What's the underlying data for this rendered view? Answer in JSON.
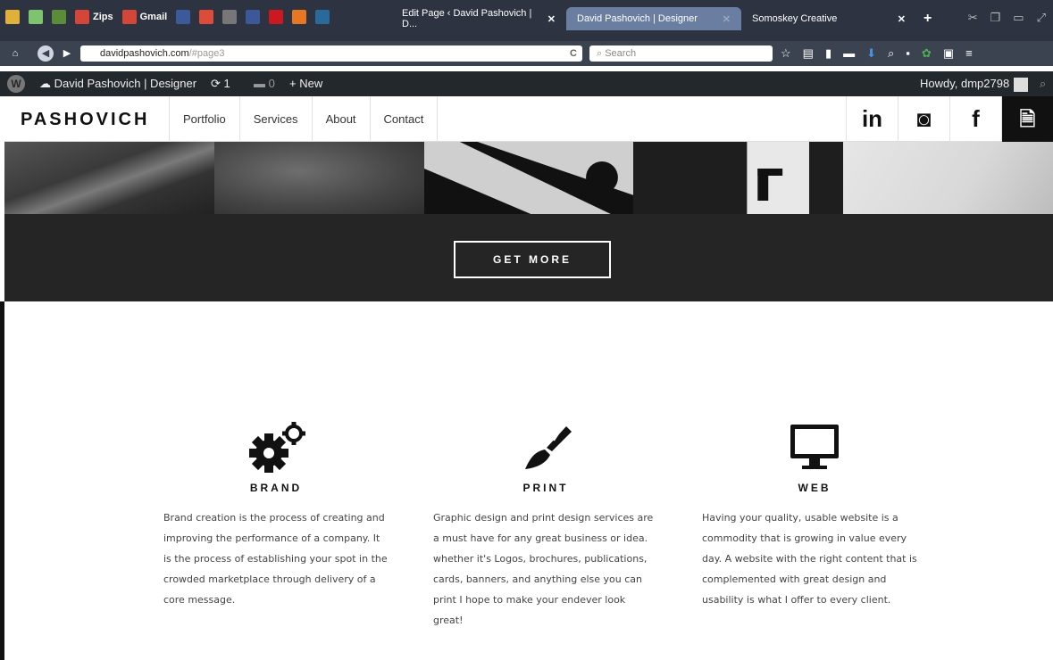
{
  "browser": {
    "bookmarks": [
      {
        "label": "",
        "color": "#e0b13a",
        "icon": "extension-icon"
      },
      {
        "label": "",
        "color": "#7ec36e",
        "icon": "calendar-icon"
      },
      {
        "label": "",
        "color": "#5a8c3a",
        "icon": "leaf-icon"
      },
      {
        "label": "Zips",
        "color": "#d44638",
        "icon": "gmail-icon"
      },
      {
        "label": "Gmail",
        "color": "#d44638",
        "icon": "gmail-icon"
      },
      {
        "label": "",
        "color": "#3b5a99",
        "icon": "rss-icon"
      },
      {
        "label": "",
        "color": "#dd4b39",
        "icon": "google-plus-icon"
      },
      {
        "label": "",
        "color": "#555",
        "icon": "instagram-icon"
      },
      {
        "label": "",
        "color": "#3b5998",
        "icon": "facebook-icon"
      },
      {
        "label": "",
        "color": "#cc181e",
        "icon": "youtube-icon"
      },
      {
        "label": "",
        "color": "#e87722",
        "icon": "blogger-icon"
      },
      {
        "label": "",
        "color": "#2a6a9a",
        "icon": "app-icon"
      }
    ],
    "tabs": [
      {
        "label": "Edit Page ‹ David Pashovich | D...",
        "active": false
      },
      {
        "label": "David Pashovich | Designer",
        "active": true
      },
      {
        "label": "Somoskey Creative",
        "active": false
      }
    ],
    "new_tab": "+",
    "url": {
      "domain": "davidpashovich.com",
      "path": "/#page3"
    },
    "search_placeholder": "Search"
  },
  "wp_admin": {
    "site_name": "David Pashovich | Designer",
    "updates": "1",
    "comments": "0",
    "new_label": "New",
    "howdy": "Howdy, dmp2798"
  },
  "site": {
    "logo": "PASHOVICH",
    "menu": [
      "Portfolio",
      "Services",
      "About",
      "Contact"
    ],
    "social": [
      "in",
      "◙",
      "f",
      "🗎"
    ],
    "cta": "GET MORE",
    "services": [
      {
        "title": "BRAND",
        "icon": "gears-icon",
        "text": "Brand creation is the process of creating and improving the performance of a company. It is the process of establishing your spot in the crowded marketplace through delivery of a core message."
      },
      {
        "title": "PRINT",
        "icon": "brush-icon",
        "text": "Graphic design and print design services are a must have for any great business or idea. whether it's Logos, brochures, publications, cards, banners, and anything else you can print I hope to make your endever look great!"
      },
      {
        "title": "WEB",
        "icon": "monitor-icon",
        "text": "Having your quality, usable website is a commodity that is growing in value every day. A website with the right content that is complemented with great design and usability is what I offer to every client."
      }
    ]
  }
}
